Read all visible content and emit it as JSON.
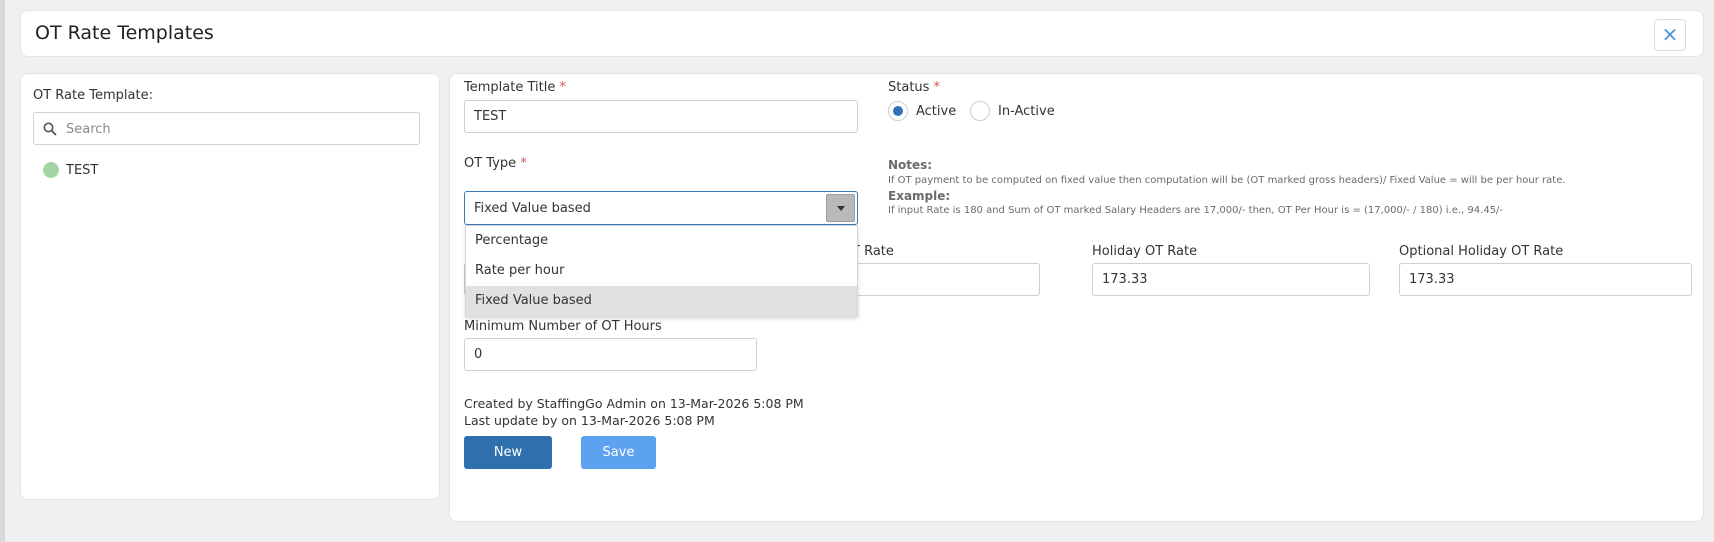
{
  "header": {
    "title": "OT Rate Templates",
    "close_label": "×"
  },
  "left_panel": {
    "label": "OT Rate Template:",
    "search_placeholder": "Search",
    "templates": [
      {
        "name": "TEST",
        "color": "#a3d6a7"
      }
    ]
  },
  "form": {
    "template_title_label": "Template Title",
    "template_title_value": "TEST",
    "status_label": "Status",
    "status_options": [
      "Active",
      "In-Active"
    ],
    "status_selected": "Active",
    "ot_type_label": "OT Type",
    "ot_type_value": "Fixed Value based",
    "ot_type_options": [
      "Percentage",
      "Rate per hour",
      "Fixed Value based"
    ],
    "notes_title": "Notes:",
    "notes_text": "If OT payment to be computed on fixed value then computation will be (OT marked gross headers)/ Fixed Value = will be per hour rate.",
    "example_title": "Example:",
    "example_text": "If input Rate is 180 and Sum of OT marked Salary Headers are 17,000/- then, OT Per Hour is = (17,000/- / 180) i.e., 94.45/-",
    "partial_label": "T Rate",
    "holiday_ot_rate_label": "Holiday OT Rate",
    "holiday_ot_rate_value": "173.33",
    "optional_holiday_ot_rate_label": "Optional Holiday OT Rate",
    "optional_holiday_ot_rate_value": "173.33",
    "min_ot_hours_label": "Minimum Number of OT Hours",
    "min_ot_hours_value": "0",
    "created_text": "Created by StaffingGo Admin on 13-Mar-2026 5:08 PM",
    "updated_text": "Last update by on 13-Mar-2026 5:08 PM",
    "required_mark": "*"
  },
  "buttons": {
    "new_label": "New",
    "save_label": "Save"
  },
  "colors": {
    "primary": "#2f6fad",
    "save": "#5da2f0",
    "required": "#d9534f"
  }
}
